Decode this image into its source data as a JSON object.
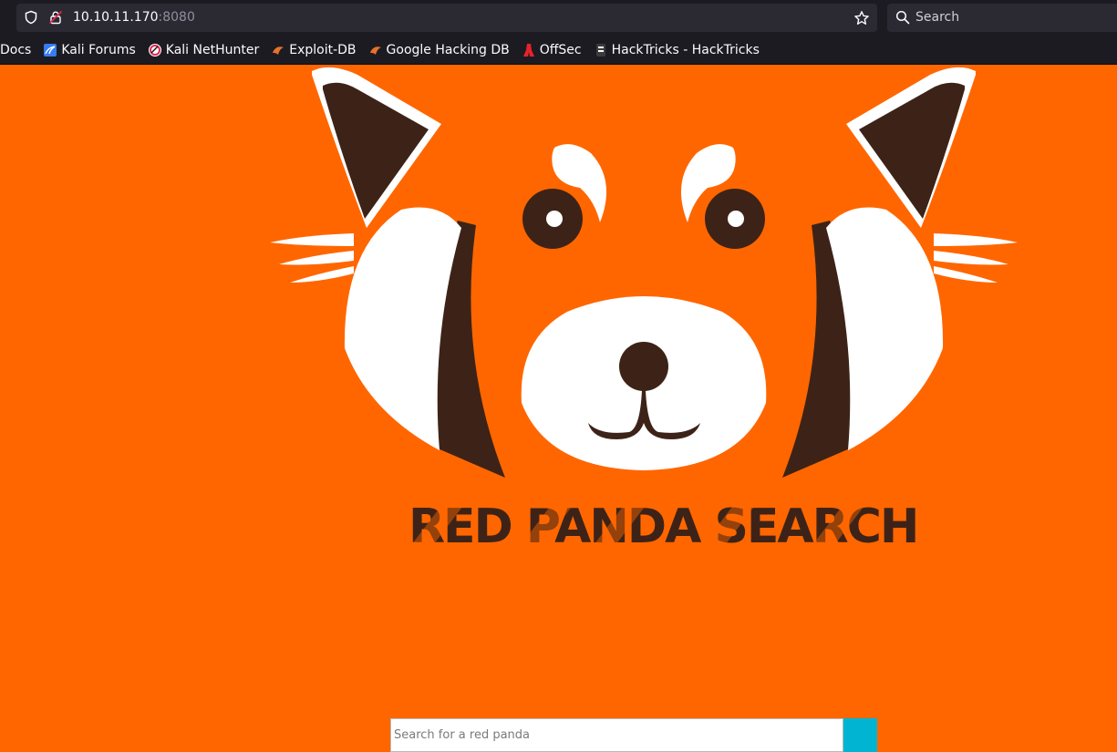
{
  "browser": {
    "url_host": "10.10.11.170",
    "url_port": ":8080",
    "search_placeholder": "Search",
    "bookmarks": [
      {
        "label": "Docs",
        "icon": "none"
      },
      {
        "label": "Kali Forums",
        "icon": "kali-forums-icon"
      },
      {
        "label": "Kali NetHunter",
        "icon": "kali-nethunter-icon"
      },
      {
        "label": "Exploit-DB",
        "icon": "exploit-db-icon"
      },
      {
        "label": "Google Hacking DB",
        "icon": "ghdb-icon"
      },
      {
        "label": "OffSec",
        "icon": "offsec-icon"
      },
      {
        "label": "HackTricks - HackTricks",
        "icon": "hacktricks-icon"
      }
    ]
  },
  "page": {
    "title": "RED PANDA SEARCH",
    "search_placeholder": "Search for a red panda",
    "colors": {
      "background": "#ff6600",
      "dark_brown": "#3d2317",
      "white": "#ffffff",
      "button": "#00b4d2"
    }
  }
}
